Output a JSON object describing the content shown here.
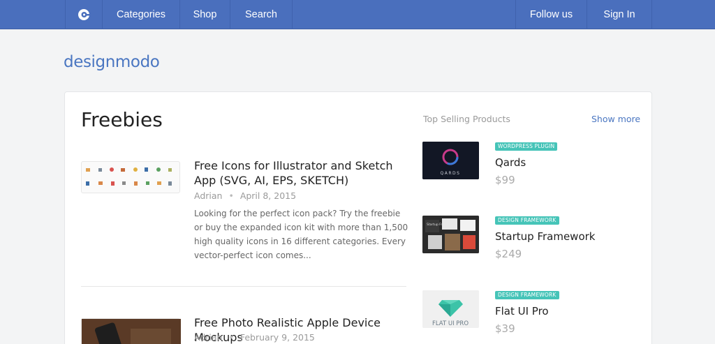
{
  "nav": {
    "logo_icon": "designmodo-logo-icon",
    "items": [
      "Categories",
      "Shop",
      "Search"
    ],
    "follow": "Follow us",
    "signin": "Sign In",
    "bg_color": "#4a6fbd"
  },
  "brand": {
    "name": "designmodo"
  },
  "page": {
    "title": "Freebies"
  },
  "posts": [
    {
      "title": "Free Icons for Illustrator and Sketch App (SVG, AI, EPS, SKETCH)",
      "author": "Adrian",
      "date": "April 8, 2015",
      "excerpt": "Looking for the perfect icon pack? Try the freebie or buy the expanded icon kit with more than 1,500 high quality icons in 16 different categories. Every vector-perfect icon comes..."
    },
    {
      "title": "Free Photo Realistic Apple Device Mockups",
      "author": "Adrian",
      "date": "February 9, 2015"
    }
  ],
  "sidebar": {
    "heading": "Top Selling Products",
    "show_more": "Show more",
    "products": [
      {
        "badge": "WORDPRESS PLUGIN",
        "name": "Qards",
        "price": "$99",
        "thumb_text": "QARDS"
      },
      {
        "badge": "DESIGN FRAMEWORK",
        "name": "Startup Framework",
        "price": "$249",
        "thumb_text": "Startup Framework"
      },
      {
        "badge": "DESIGN FRAMEWORK",
        "name": "Flat UI Pro",
        "price": "$39",
        "thumb_text": "FLAT UI PRO"
      }
    ],
    "badge_color": "#46c4b8"
  },
  "separator": "•"
}
